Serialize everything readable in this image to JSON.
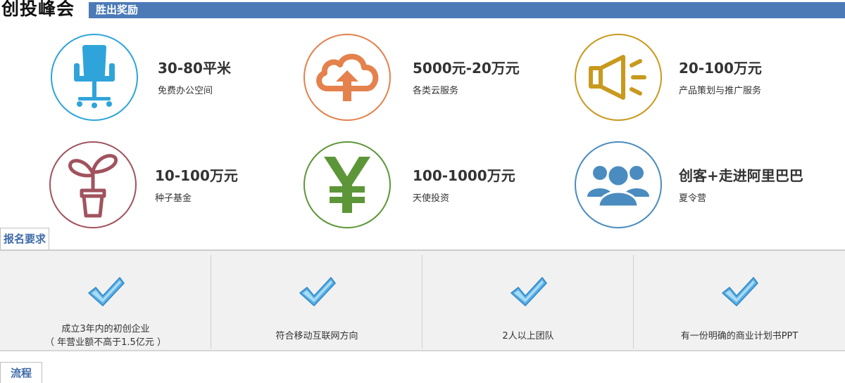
{
  "header": {
    "brand": "创投峰会",
    "banner_label": "胜出奖励"
  },
  "colors": {
    "banner": "#4c7ab7",
    "chair": "#2fa4da",
    "cloud": "#e4814c",
    "speaker": "#c9991e",
    "plant": "#a0535e",
    "yen": "#5d9638",
    "people": "#4a8cbf",
    "tab_text": "#3e6aa8"
  },
  "rewards": [
    {
      "icon": "office-chair-icon",
      "title": "30-80平米",
      "subtitle": "免费办公空间"
    },
    {
      "icon": "cloud-upload-icon",
      "title": "5000元-20万元",
      "subtitle": "各类云服务"
    },
    {
      "icon": "megaphone-icon",
      "title": "20-100万元",
      "subtitle": "产品策划与推广服务"
    },
    {
      "icon": "sprout-icon",
      "title": "10-100万元",
      "subtitle": "种子基金"
    },
    {
      "icon": "yen-icon",
      "title": "100-1000万元",
      "subtitle": "天使投资"
    },
    {
      "icon": "team-icon",
      "title": "创客+走进阿里巴巴",
      "subtitle": "夏令营"
    }
  ],
  "requirements_section": {
    "tab_label": "报名要求",
    "items": [
      {
        "icon": "checkmark-icon",
        "line1": "成立3年内的初创企业",
        "line2": "（ 年营业额不高于1.5亿元 ）"
      },
      {
        "icon": "checkmark-icon",
        "line1": "符合移动互联网方向"
      },
      {
        "icon": "checkmark-icon",
        "line1": "2人以上团队"
      },
      {
        "icon": "checkmark-icon",
        "line1": "有一份明确的商业计划书PPT"
      }
    ]
  },
  "process_section": {
    "tab_label": "流程"
  }
}
